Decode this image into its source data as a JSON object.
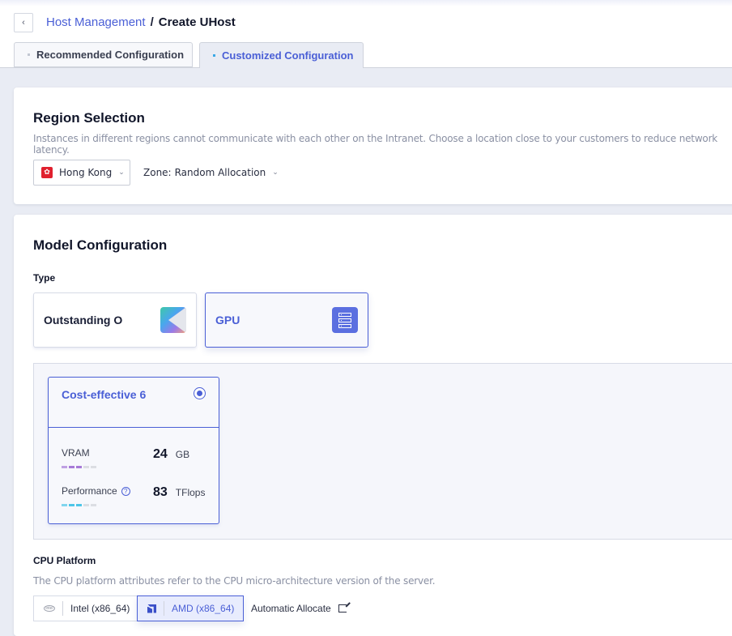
{
  "header": {
    "back_icon": "chevron-left-icon",
    "breadcrumb": {
      "parent": "Host Management",
      "separator": "/",
      "current": "Create UHost"
    },
    "tabs": [
      {
        "label": "Recommended Configuration",
        "active": false
      },
      {
        "label": "Customized Configuration",
        "active": true
      }
    ]
  },
  "region": {
    "title": "Region Selection",
    "description": "Instances in different regions cannot communicate with each other on the Intranet. Choose a location close to your customers to reduce network latency.",
    "region_value": "Hong Kong",
    "region_icon": "hong-kong-flag-icon",
    "zone_label": "Zone:",
    "zone_value": "Random Allocation"
  },
  "model": {
    "title": "Model Configuration",
    "type_label": "Type",
    "types": [
      {
        "label": "Outstanding O",
        "icon": "outstanding-logo-icon",
        "selected": false
      },
      {
        "label": "GPU",
        "icon": "server-icon",
        "selected": true
      }
    ],
    "gpu_spec": {
      "name": "Cost-effective 6",
      "selected": true,
      "vram": {
        "label": "VRAM",
        "value": "24",
        "unit": "GB",
        "level": 3,
        "max_level": 5,
        "color": "#a77ad8"
      },
      "performance": {
        "label": "Performance",
        "value": "83",
        "unit": "TFlops",
        "level": 3,
        "max_level": 5,
        "color": "#4ec6e8"
      }
    },
    "cpu_platform": {
      "label": "CPU Platform",
      "description": "The CPU platform attributes refer to the CPU micro-architecture version of the server.",
      "options": [
        {
          "label": "Intel (x86_64)",
          "icon": "intel-logo-icon",
          "selected": false
        },
        {
          "label": "AMD (x86_64)",
          "icon": "amd-logo-icon",
          "selected": true
        }
      ],
      "auto_label": "Automatic Allocate",
      "auto_icon": "external-link-icon"
    }
  },
  "colors": {
    "accent": "#4a5fd6",
    "page_bg": "#e9ecf4"
  }
}
